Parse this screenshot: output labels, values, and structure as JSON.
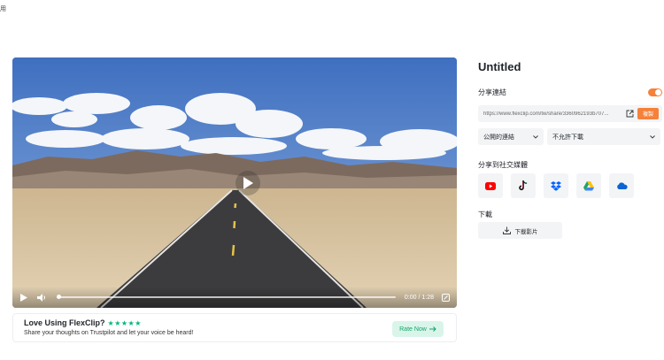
{
  "corner": {
    "text": "用"
  },
  "player": {
    "time": "0:00 / 1:28",
    "progress_fraction": 0.0
  },
  "rating": {
    "title": "Love Using FlexClip?",
    "stars": "★★★★★",
    "subtitle": "Share your thoughts on Trustpilot and let your voice be heard!",
    "button_label": "Rate Now"
  },
  "panel": {
    "title": "Untitled",
    "share_link_label": "分享連結",
    "share_enabled": true,
    "link_url": "https://www.flexclip.com/tw/share/3360962193b707...",
    "copy_label": "複製",
    "visibility_select": "公開的連結",
    "download_select": "不允許下載",
    "social_label": "分享到社交媒體",
    "socials": [
      {
        "icon": "youtube-icon",
        "color": "#ff0000"
      },
      {
        "icon": "tiktok-icon",
        "color": "#111111"
      },
      {
        "icon": "dropbox-icon",
        "color": "#0061ff"
      },
      {
        "icon": "google-drive-icon",
        "color": "#1fa463"
      },
      {
        "icon": "onedrive-icon",
        "color": "#0a64d6"
      }
    ],
    "download_label": "下載",
    "download_button": "下載影片"
  },
  "colors": {
    "accent": "#f5813a",
    "rate_green": "#16a36c",
    "star_green": "#00b67a"
  }
}
